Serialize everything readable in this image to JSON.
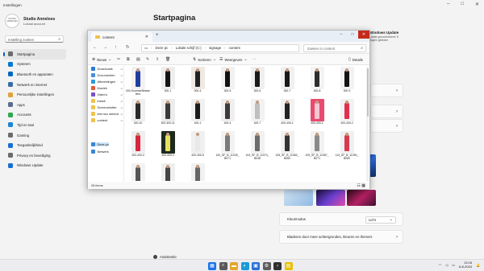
{
  "settings": {
    "window_title": "Instellingen",
    "profile": {
      "avatar_text": "STUDIO ANNELOES",
      "name": "Studio Anneloes",
      "account": "Lokaal account"
    },
    "search_placeholder": "Instelling zoeken",
    "nav": [
      {
        "label": "Startpagina",
        "icon": "home-icon",
        "color": "#6b6b6b",
        "active": true
      },
      {
        "label": "Systeem",
        "icon": "monitor-icon",
        "color": "#0078d4"
      },
      {
        "label": "Bluetooth en apparaten",
        "icon": "bluetooth-icon",
        "color": "#0067c0"
      },
      {
        "label": "Netwerk en internet",
        "icon": "wifi-icon",
        "color": "#3a6ea5"
      },
      {
        "label": "Persoonlijke instellingen",
        "icon": "brush-icon",
        "color": "#e3a13b"
      },
      {
        "label": "Apps",
        "icon": "apps-icon",
        "color": "#5a6d8a"
      },
      {
        "label": "Accounts",
        "icon": "person-icon",
        "color": "#2fa84f"
      },
      {
        "label": "Tijd en taal",
        "icon": "clock-icon",
        "color": "#1a86d9"
      },
      {
        "label": "Gaming",
        "icon": "controller-icon",
        "color": "#6b6b6b"
      },
      {
        "label": "Toegankelijkheid",
        "icon": "accessibility-icon",
        "color": "#1a6ed1"
      },
      {
        "label": "Privacy en beveiliging",
        "icon": "shield-icon",
        "color": "#6b6b6b"
      },
      {
        "label": "Windows Update",
        "icon": "update-icon",
        "color": "#1a6ed1"
      }
    ],
    "page_title": "Startpagina",
    "right_panel": {
      "title": "Windows Update",
      "subtitle": "Laatst gecontroleerd: 5 dagen geleden"
    },
    "kleurmodus_label": "Kleurmodus",
    "kleurmodus_value": "Licht",
    "background_link": "Bladeren door meer achtergronden, kleuren en thema's",
    "assist_label": "Assistentie"
  },
  "explorer": {
    "tab_title": "content",
    "address": [
      "Deze pc",
      "Lokale schijf (C:)",
      "signage",
      "content"
    ],
    "search_placeholder": "Zoeken in content",
    "toolbar": {
      "new": "Nieuw",
      "sort": "Sorteren",
      "view": "Weergeven",
      "more": "···",
      "details": "Details"
    },
    "sidebar": [
      {
        "label": "Downloads",
        "color": "#2b7bd6"
      },
      {
        "label": "Documenten",
        "color": "#4a90d9"
      },
      {
        "label": "Afbeeldingen",
        "color": "#2f9ad9"
      },
      {
        "label": "Muziek",
        "color": "#e15b3c"
      },
      {
        "label": "Video's",
        "color": "#7b4fc9"
      },
      {
        "label": "install",
        "color": "#f0c24b"
      },
      {
        "label": "Screenshotter",
        "color": "#f0c24b"
      },
      {
        "label": "test nux steand",
        "color": "#f0c24b"
      },
      {
        "label": "content",
        "color": "#f0c24b"
      },
      {
        "label": "Deze pc",
        "color": "#3a86d4"
      },
      {
        "label": "Netwerk",
        "color": "#3a86d4"
      }
    ],
    "files": [
      {
        "name": "000-SummerBestsellers",
        "bg": "#f2f2f2",
        "fig": "#1d3fa0"
      },
      {
        "name": "300-1",
        "bg": "#eeeeee",
        "fig": "#151515"
      },
      {
        "name": "300-4",
        "bg": "#efe9e4",
        "fig": "#222222"
      },
      {
        "name": "300-5",
        "bg": "#f1f1f1",
        "fig": "#111111"
      },
      {
        "name": "300-6",
        "bg": "#efefef",
        "fig": "#1a1a1a"
      },
      {
        "name": "300-7",
        "bg": "#f0f0f0",
        "fig": "#191919"
      },
      {
        "name": "300-8",
        "bg": "#f3f3f3",
        "fig": "#2d2d2d"
      },
      {
        "name": "300-9",
        "bg": "#f2f2f2",
        "fig": "#141414"
      },
      {
        "name": "300-10",
        "bg": "#efefef",
        "fig": "#2a2a2a"
      },
      {
        "name": "300-300-11",
        "bg": "#ececec",
        "fig": "#3a3a3a"
      },
      {
        "name": "400-1",
        "bg": "#f1f1f1",
        "fig": "#1c1c1c"
      },
      {
        "name": "400-4",
        "bg": "#f0eeee",
        "fig": "#3b3b3b"
      },
      {
        "name": "400-7",
        "bg": "#f2f2f2",
        "fig": "#bfbfbf"
      },
      {
        "name": "400-400-1",
        "bg": "#f1f1f1",
        "fig": "#222222"
      },
      {
        "name": "400-400-1",
        "bg": "#e94a6f",
        "fig": "#f5c7d4"
      },
      {
        "name": "400-400-2",
        "bg": "#f2f2f2",
        "fig": "#e0304e"
      },
      {
        "name": "400-400-3",
        "bg": "#efefef",
        "fig": "#d8263e"
      },
      {
        "name": "400-400-4",
        "bg": "#1f2a1f",
        "fig": "#e7e060"
      },
      {
        "name": "400-400-5",
        "bg": "#f0f0f0",
        "fig": "#e9e9e9"
      },
      {
        "name": "100_SF_B_11039_B071",
        "bg": "#f2f2f2",
        "fig": "#7a7a7a"
      },
      {
        "name": "103_SF_B_11070_B048",
        "bg": "#f1f1f1",
        "fig": "#6b6b6b"
      },
      {
        "name": "105_SF_B_11082_B080",
        "bg": "#f0f0f0",
        "fig": "#333333"
      },
      {
        "name": "109_SF_B_11087_B071",
        "bg": "#f2f2f2",
        "fig": "#8a8a8a"
      },
      {
        "name": "113_SF_B_11090_B080",
        "bg": "#f0f0f0",
        "fig": "#d63a4e"
      },
      {
        "name": "",
        "bg": "#f2f2f2",
        "fig": "#555555"
      },
      {
        "name": "",
        "bg": "#efefef",
        "fig": "#444444"
      },
      {
        "name": "",
        "bg": "#f1f1f1",
        "fig": "#666666"
      }
    ],
    "status": "28 items"
  },
  "taskbar": {
    "icons": [
      {
        "name": "start-icon",
        "color": "#1a73e8",
        "glyph": "▦"
      },
      {
        "name": "search-icon",
        "color": "#5a5a5a",
        "glyph": "⌕"
      },
      {
        "name": "file-explorer-icon",
        "color": "#e0a82e",
        "glyph": "▬"
      },
      {
        "name": "edge-icon",
        "color": "#1a9bd7",
        "glyph": "◐"
      },
      {
        "name": "store-icon",
        "color": "#2c6fd6",
        "glyph": "▣"
      },
      {
        "name": "settings-icon",
        "color": "#5d5d5d",
        "glyph": "⚙"
      },
      {
        "name": "terminal-icon",
        "color": "#303030",
        "glyph": "›"
      },
      {
        "name": "app-icon",
        "color": "#e7c000",
        "glyph": "▤"
      }
    ],
    "time": "13:18",
    "date": "6-8-2024"
  }
}
